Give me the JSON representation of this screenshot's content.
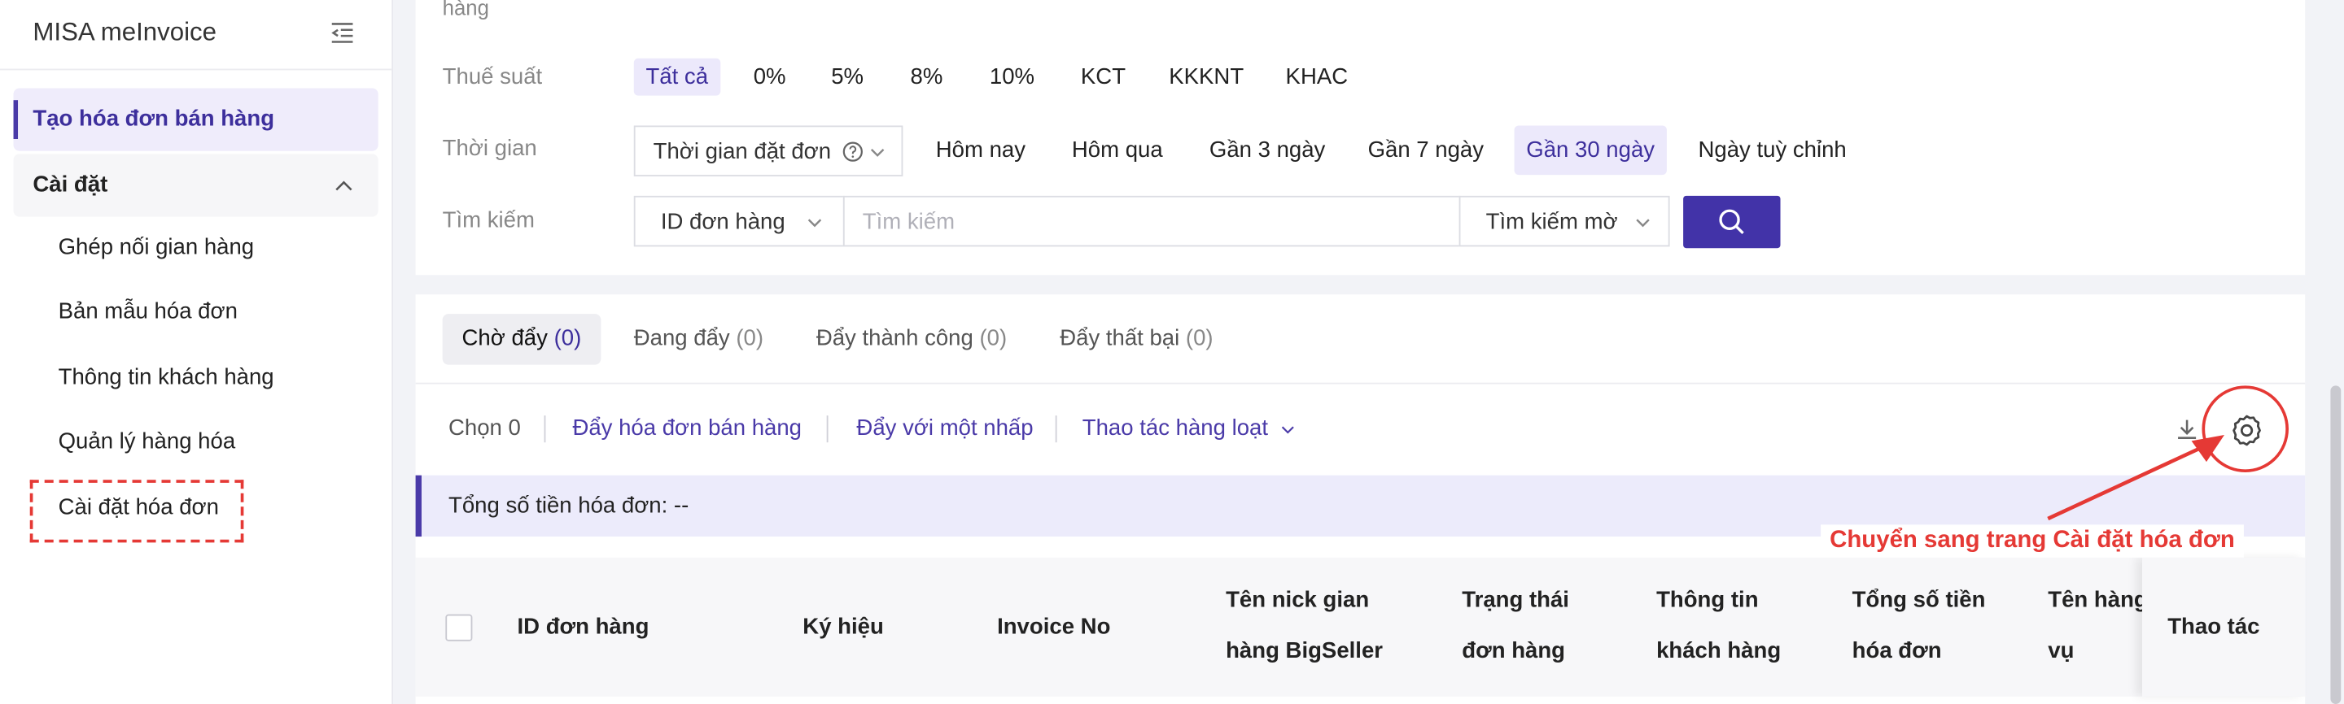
{
  "sidebar": {
    "logo": "MISA meInvoice",
    "active_item": "Tạo hóa đơn bán hàng",
    "group_label": "Cài đặt",
    "items": [
      {
        "label": "Ghép nối gian hàng"
      },
      {
        "label": "Bản mẫu hóa đơn"
      },
      {
        "label": "Thông tin khách hàng"
      },
      {
        "label": "Quản lý hàng hóa"
      },
      {
        "label": "Cài đặt hóa đơn"
      }
    ]
  },
  "filters": {
    "top_partial": "hàng",
    "tax": {
      "label": "Thuế suất",
      "options": [
        "Tất cả",
        "0%",
        "5%",
        "8%",
        "10%",
        "KCT",
        "KKKNT",
        "KHAC"
      ],
      "selected": "Tất cả"
    },
    "time": {
      "label": "Thời gian",
      "select_value": "Thời gian đặt đơn",
      "options": [
        "Hôm nay",
        "Hôm qua",
        "Gần 3 ngày",
        "Gần 7 ngày",
        "Gần 30 ngày",
        "Ngày tuỳ chỉnh"
      ],
      "selected": "Gần 30 ngày"
    },
    "search": {
      "label": "Tìm kiếm",
      "field_select": "ID đơn hàng",
      "placeholder": "Tìm kiếm",
      "mode_select": "Tìm kiếm mờ"
    }
  },
  "tabs": [
    {
      "label": "Chờ đẩy",
      "count": "(0)"
    },
    {
      "label": "Đang đẩy",
      "count": "(0)"
    },
    {
      "label": "Đẩy thành công",
      "count": "(0)"
    },
    {
      "label": "Đẩy thất bại",
      "count": "(0)"
    }
  ],
  "actions": {
    "selected_count": "Chọn 0",
    "push_sales_invoice": "Đẩy hóa đơn bán hàng",
    "push_one_click": "Đẩy với một nhấp",
    "bulk_actions": "Thao tác hàng loạt"
  },
  "total_bar": "Tổng số tiền hóa đơn: --",
  "table": {
    "headers": [
      {
        "line1": "ID đơn hàng",
        "line2": ""
      },
      {
        "line1": "Ký hiệu",
        "line2": ""
      },
      {
        "line1": "Invoice No",
        "line2": ""
      },
      {
        "line1": "Tên nick gian",
        "line2": "hàng BigSeller"
      },
      {
        "line1": "Trạng thái",
        "line2": "đơn hàng"
      },
      {
        "line1": "Thông tin",
        "line2": "khách hàng"
      },
      {
        "line1": "Tổng số tiền",
        "line2": "hóa đơn"
      },
      {
        "line1": "Tên hàng",
        "line2": "vụ"
      },
      {
        "line1": "Thao tác",
        "line2": ""
      }
    ]
  },
  "annotation": "Chuyển sang trang Cài đặt hóa đơn",
  "colors": {
    "primary": "#4233a8",
    "active_text": "#3d2f9c",
    "selected_bg": "#ece9fb",
    "annotation_red": "#e53935"
  }
}
